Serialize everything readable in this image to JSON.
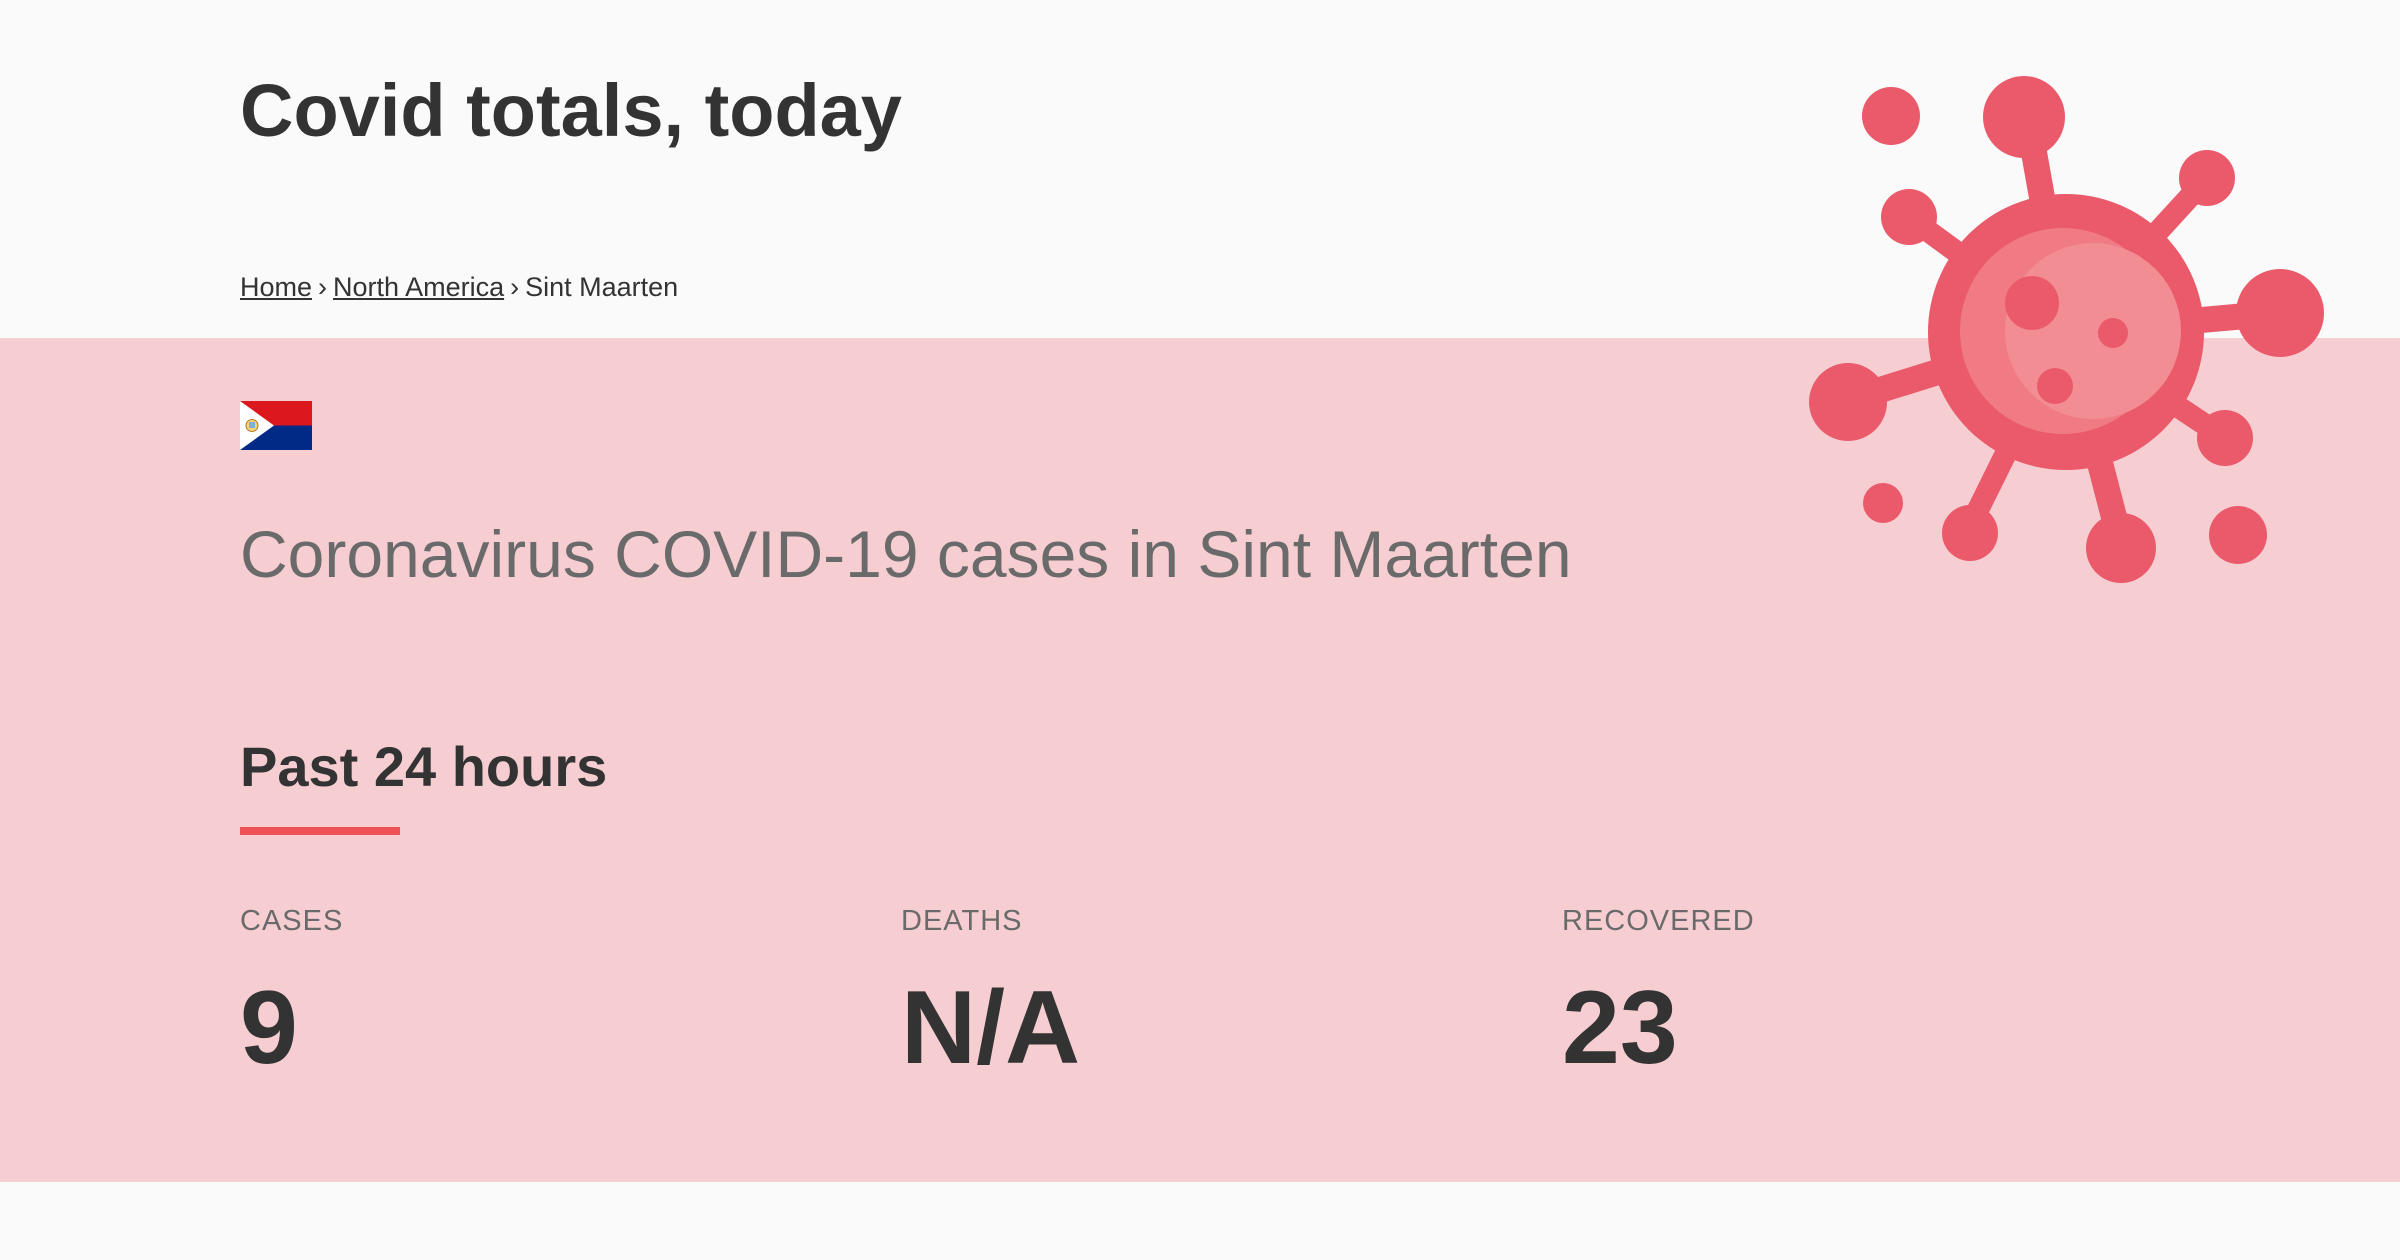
{
  "header": {
    "title": "Covid totals, today"
  },
  "breadcrumb": {
    "items": [
      {
        "label": "Home",
        "link": true
      },
      {
        "label": "North America",
        "link": true
      },
      {
        "label": "Sint Maarten",
        "link": false
      }
    ],
    "separator": "›"
  },
  "country": {
    "flag_icon": "sint-maarten-flag-icon",
    "heading": "Coronavirus COVID-19 cases in Sint Maarten"
  },
  "period": {
    "title": "Past 24 hours",
    "accent_color": "#ee5257"
  },
  "stats": [
    {
      "label": "CASES",
      "value": "9"
    },
    {
      "label": "DEATHS",
      "value": "N/A"
    },
    {
      "label": "RECOVERED",
      "value": "23"
    }
  ],
  "illustration": {
    "icon": "virus-icon",
    "color": "#ea5a6a"
  },
  "colors": {
    "band_background": "#f6ced2",
    "page_background": "#fafafa"
  }
}
